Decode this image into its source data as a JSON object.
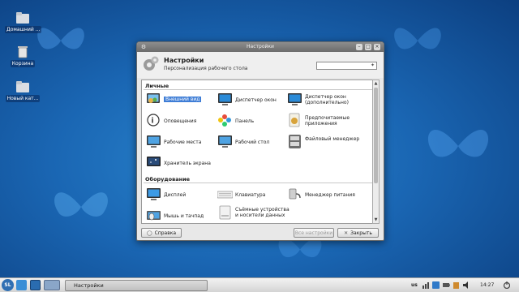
{
  "desktop": {
    "icons": [
      {
        "label": "Домашний ..."
      },
      {
        "label": "Корзина"
      },
      {
        "label": "Новый кат..."
      }
    ]
  },
  "window": {
    "title": "Настройки",
    "header": {
      "title": "Настройки",
      "subtitle": "Персонализация рабочего стола",
      "search_value": ""
    },
    "sections": [
      {
        "title": "Личные",
        "items": [
          {
            "label": "Внешний вид",
            "icon": "appearance-icon"
          },
          {
            "label": "Диспетчер окон",
            "icon": "window-manager-icon"
          },
          {
            "label": "Диспетчер окон (дополнительно)",
            "icon": "window-manager-advanced-icon"
          },
          {
            "label": "Оповещения",
            "icon": "notifications-icon"
          },
          {
            "label": "Панель",
            "icon": "panel-icon"
          },
          {
            "label": "Предпочитаемые приложения",
            "icon": "preferred-apps-icon"
          },
          {
            "label": "Рабочие места",
            "icon": "workspaces-icon"
          },
          {
            "label": "Рабочий стол",
            "icon": "desktop-icon"
          },
          {
            "label": "Файловый менеджер",
            "icon": "file-manager-icon"
          },
          {
            "label": "Хранитель экрана",
            "icon": "screensaver-icon"
          }
        ]
      },
      {
        "title": "Оборудование",
        "items": [
          {
            "label": "Дисплей",
            "icon": "display-icon"
          },
          {
            "label": "Клавиатура",
            "icon": "keyboard-icon"
          },
          {
            "label": "Менеджер питания",
            "icon": "power-manager-icon"
          },
          {
            "label": "Мышь и тачпад",
            "icon": "mouse-icon"
          },
          {
            "label": "Съёмные устройства и носители данных",
            "icon": "removable-drives-icon"
          }
        ]
      }
    ],
    "buttons": {
      "help": "Справка",
      "all_settings": "Все настройки",
      "close": "Закрыть"
    }
  },
  "taskbar": {
    "start_label": "SL",
    "task_label": "Настройки",
    "keyboard_layout": "us",
    "clock": "14:27"
  },
  "colors": {
    "desktop_blue": "#1a66b3",
    "selection": "#3e7dd6"
  }
}
